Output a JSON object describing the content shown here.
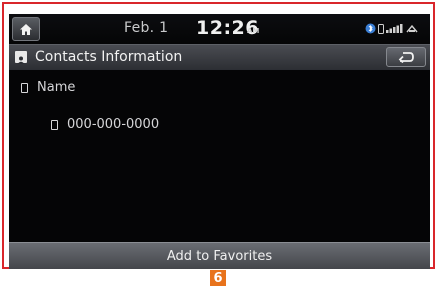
{
  "status_bar": {
    "date": "Feb.  1",
    "time": "12:26",
    "ampm": "AM"
  },
  "title_bar": {
    "title": "Contacts Information"
  },
  "contact": {
    "name": "Name",
    "phone": "000-000-0000"
  },
  "actions": {
    "add_favorites_label": "Add to Favorites"
  },
  "callout": {
    "label": "6"
  },
  "icons": {
    "home": "home-icon",
    "contacts": "contact-card-icon",
    "back": "back-arrow-icon",
    "name": "person-icon",
    "phone": "phone-icon",
    "bluetooth": "bluetooth-icon",
    "signal": "signal-strength-icon",
    "battery": "battery-icon"
  },
  "colors": {
    "frame": "#d9262b",
    "callout": "#e8731c",
    "screen_bg": "#050506"
  }
}
